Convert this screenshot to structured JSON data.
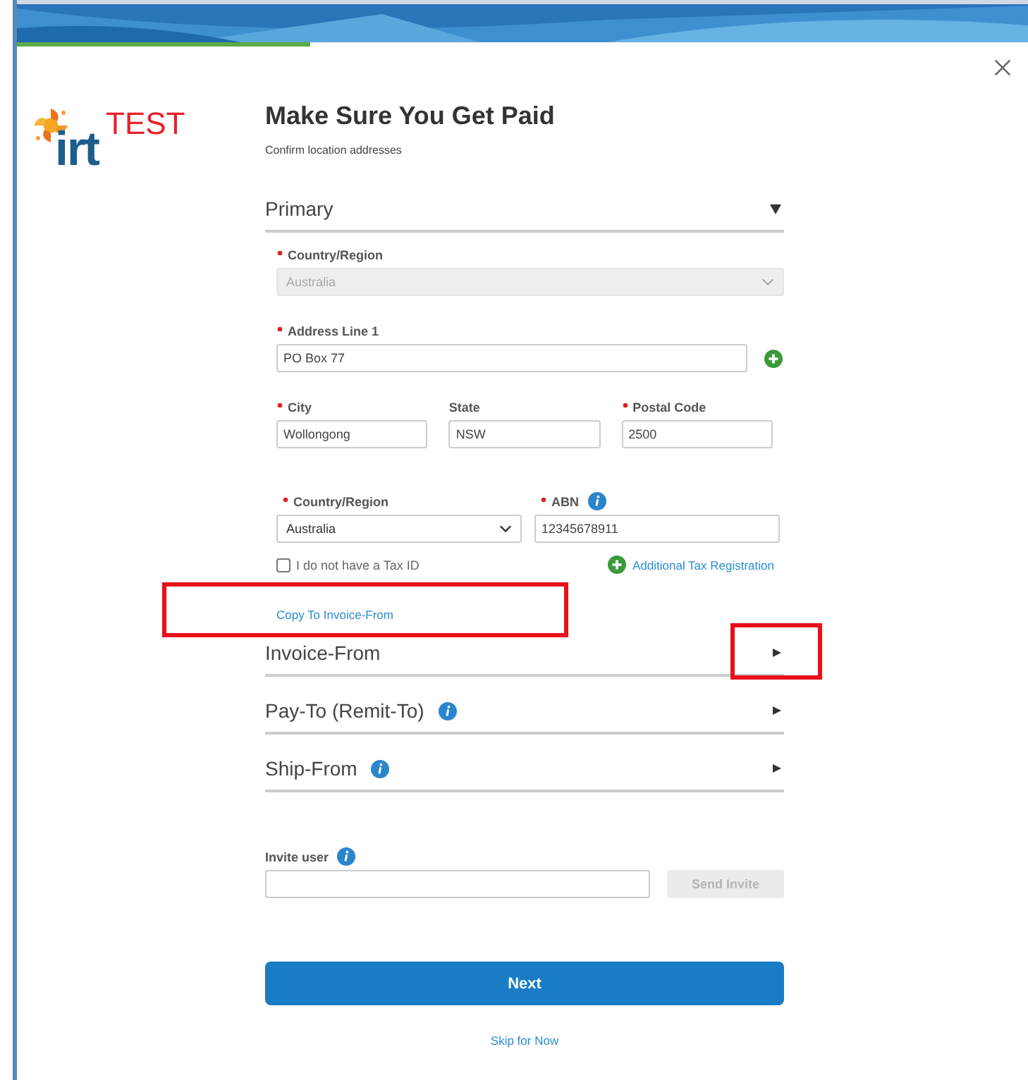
{
  "logo": {
    "wordmark": "irt",
    "badge": "TEST"
  },
  "header": {
    "title": "Make Sure You Get Paid",
    "subtitle": "Confirm location addresses"
  },
  "primary": {
    "title": "Primary",
    "expanded": true,
    "country": {
      "label": "Country/Region",
      "required": true,
      "value": "Australia",
      "disabled": true
    },
    "address_line_1": {
      "label": "Address Line 1",
      "required": true,
      "value": "PO Box 77"
    },
    "city": {
      "label": "City",
      "required": true,
      "value": "Wollongong"
    },
    "state": {
      "label": "State",
      "required": false,
      "value": "NSW"
    },
    "postal_code": {
      "label": "Postal Code",
      "required": true,
      "value": "2500"
    },
    "tax_country": {
      "label": "Country/Region",
      "required": true,
      "value": "Australia",
      "disabled": false
    },
    "abn": {
      "label": "ABN",
      "required": true,
      "value": "12345678911",
      "info": true
    },
    "no_tax_id": {
      "label": "I do not have a Tax ID",
      "checked": false
    },
    "additional_tax": "Additional Tax Registration",
    "copy_link": "Copy To Invoice-From"
  },
  "sections": [
    {
      "title": "Invoice-From",
      "info": false,
      "expanded": false
    },
    {
      "title": "Pay-To (Remit-To)",
      "info": true,
      "expanded": false
    },
    {
      "title": "Ship-From",
      "info": true,
      "expanded": false
    }
  ],
  "invite": {
    "label": "Invite user",
    "info": true,
    "button": "Send Invite",
    "button_disabled": true
  },
  "next_button": "Next",
  "skip_link": "Skip for Now"
}
